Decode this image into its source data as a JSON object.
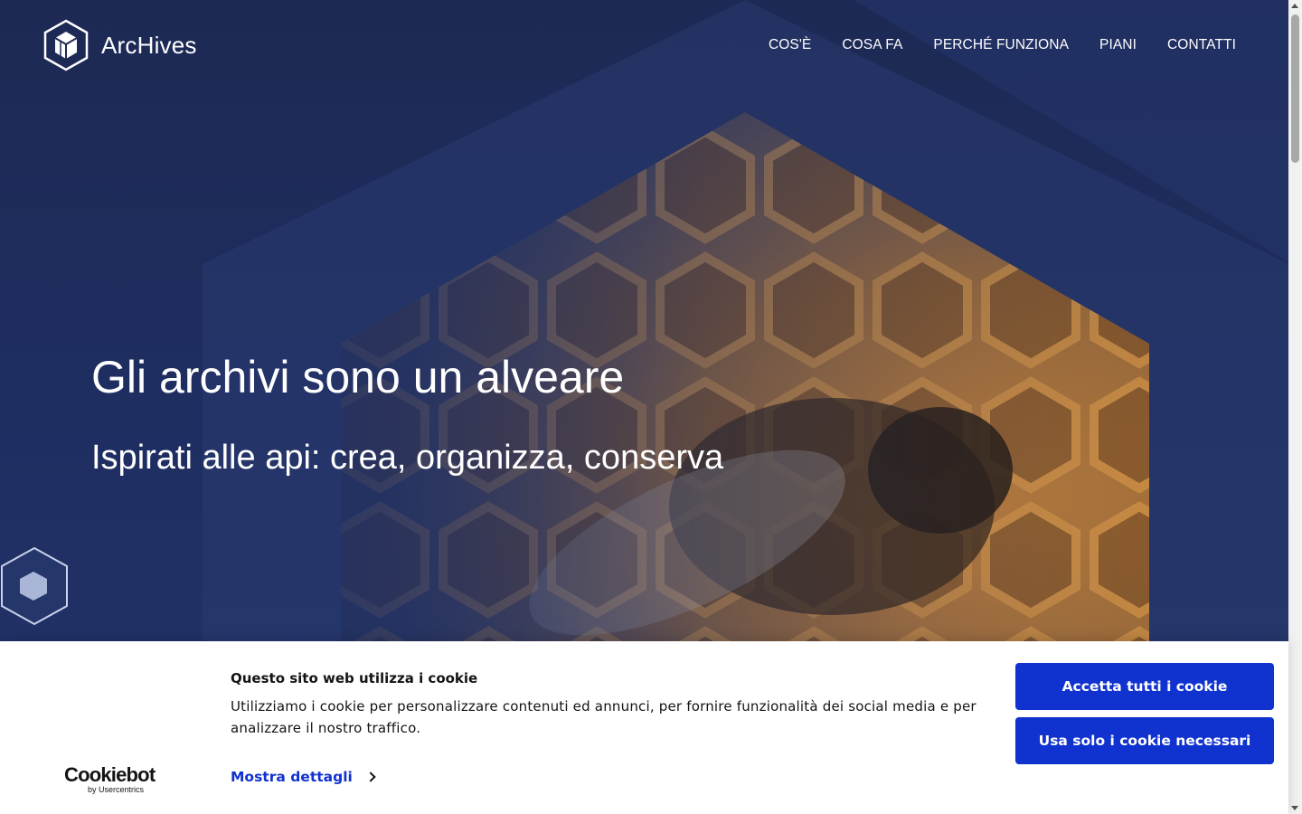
{
  "brand": {
    "name": "ArcHives"
  },
  "nav": {
    "items": [
      {
        "label": "COS'È"
      },
      {
        "label": "COSA FA"
      },
      {
        "label": "PERCHÉ FUNZIONA"
      },
      {
        "label": "PIANI"
      },
      {
        "label": "CONTATTI"
      }
    ]
  },
  "hero": {
    "title": "Gli archivi sono un alveare",
    "subtitle": "Ispirati alle api: crea, organizza, conserva",
    "image": "honeycomb-bee-photo"
  },
  "cookie_banner": {
    "title": "Questo sito web utilizza i cookie",
    "text": "Utilizziamo i cookie per personalizzare contenuti ed annunci, per fornire funzionalità dei social media e per analizzare il nostro traffico.",
    "details_link": "Mostra dettagli",
    "accept_all": "Accetta tutti i cookie",
    "necessary_only": "Usa solo i cookie necessari",
    "provider": "Cookiebot",
    "provider_sub": "by Usercentrics"
  },
  "colors": {
    "hero_bg": "#1d2954",
    "cookie_button": "#1032cf",
    "honey": "#c8862f"
  },
  "icons": {
    "logo": "archives-cube-icon",
    "widget": "hexagon-icon",
    "details_chevron": "chevron-right-icon"
  }
}
